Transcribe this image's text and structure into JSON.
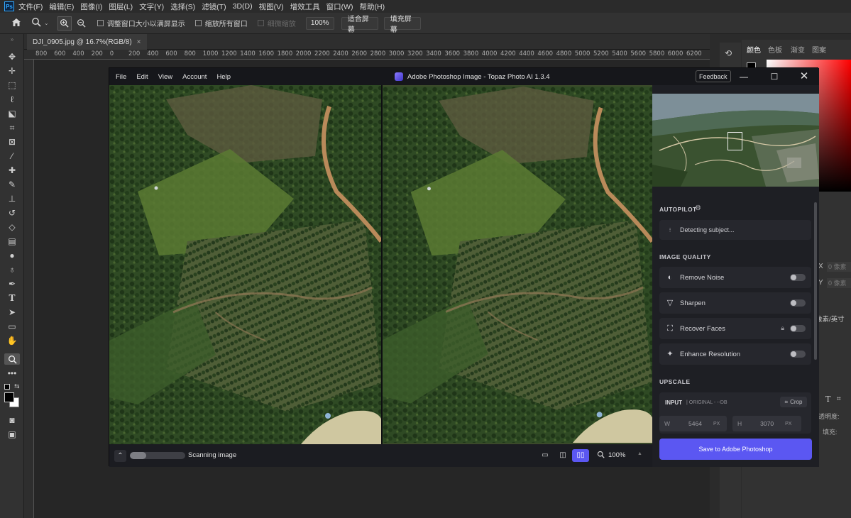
{
  "photoshop": {
    "logo": "Ps",
    "menus": [
      "文件(F)",
      "编辑(E)",
      "图像(I)",
      "图层(L)",
      "文字(Y)",
      "选择(S)",
      "滤镜(T)",
      "3D(D)",
      "视图(V)",
      "增效工具",
      "窗口(W)",
      "帮助(H)"
    ],
    "options": {
      "resize_windows_label": "调整窗口大小以满屏显示",
      "zoom_all_label": "缩放所有窗口",
      "scrubby_zoom_label": "细微缩放",
      "zoom_value": "100%",
      "fit_screen_label": "适合屏幕",
      "fill_screen_label": "填充屏幕"
    },
    "document_tab": "DJI_0905.jpg @ 16.7%(RGB/8)",
    "ruler_ticks": [
      "800",
      "600",
      "400",
      "200",
      "0",
      "200",
      "400",
      "600",
      "800",
      "1000",
      "1200",
      "1400",
      "1600",
      "1800",
      "2000",
      "2200",
      "2400",
      "2600",
      "2800",
      "3000",
      "3200",
      "3400",
      "3600",
      "3800",
      "4000",
      "4200",
      "4400",
      "4600",
      "4800",
      "5000",
      "5200",
      "5400",
      "5600",
      "5800",
      "6000",
      "6200"
    ],
    "right_panel": {
      "tabs": [
        "颜色",
        "色板",
        "渐变",
        "图案"
      ],
      "x_label": "X",
      "x_value": "0 像素",
      "y_label": "Y",
      "y_value": "0 像素",
      "unit_label": "像素/英寸",
      "opacity_label": "透明度:",
      "fill_label": "填充:",
      "type_icon_label": "T"
    }
  },
  "topaz": {
    "menus": [
      "File",
      "Edit",
      "View",
      "Account",
      "Help"
    ],
    "title": "Adobe Photoshop Image - Topaz Photo AI 1.3.4",
    "feedback_label": "Feedback",
    "autopilot": {
      "label": "AUTOPILOT",
      "status": "Detecting subject..."
    },
    "image_quality": {
      "label": "IMAGE QUALITY",
      "items": [
        {
          "label": "Remove Noise",
          "icon": "remove-noise-icon"
        },
        {
          "label": "Sharpen",
          "icon": "sharpen-icon"
        },
        {
          "label": "Recover Faces",
          "icon": "recover-faces-icon"
        },
        {
          "label": "Enhance Resolution",
          "icon": "enhance-resolution-icon"
        }
      ]
    },
    "upscale": {
      "label": "UPSCALE",
      "input_label": "INPUT",
      "input_detail": "| ORIGINAL - --DB",
      "crop_label": "Crop",
      "width_label": "W",
      "width_value": "5464",
      "width_unit": "PX",
      "height_label": "H",
      "height_value": "3070",
      "height_unit": "PX"
    },
    "save_label": "Save to Adobe Photoshop",
    "bottom": {
      "status": "Scanning image",
      "progress": 0.3,
      "zoom": "100%"
    },
    "colors": {
      "accent": "#5b57f2",
      "panel": "#1e1f24",
      "row": "#26272d"
    }
  }
}
